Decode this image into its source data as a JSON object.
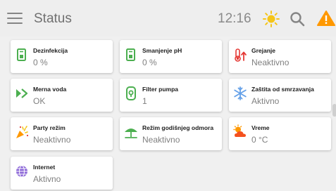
{
  "header": {
    "title": "Status",
    "time": "12:16",
    "menu_icon": "hamburger-menu-icon",
    "weather_icon": "sun-icon",
    "search_icon": "search-icon",
    "alert_icon": "warning-icon"
  },
  "colors": {
    "green": "#4caf50",
    "red": "#e53935",
    "orange": "#ff9800",
    "blue": "#64a0e8",
    "purple": "#8e6ad8",
    "yellow": "#f5c518"
  },
  "tiles": [
    {
      "label": "Dezinfekcija",
      "value": "0 %",
      "icon": "dosing-pump-icon"
    },
    {
      "label": "Smanjenje pH",
      "value": "0 %",
      "icon": "dosing-pump-icon"
    },
    {
      "label": "Grejanje",
      "value": "Neaktivno",
      "icon": "heating-thermometer-icon"
    },
    {
      "label": "Merna voda",
      "value": "OK",
      "icon": "flow-arrows-icon"
    },
    {
      "label": "Filter pumpa",
      "value": "1",
      "icon": "filter-pump-icon"
    },
    {
      "label": "Zaštita od smrzavanja",
      "value": "Aktivno",
      "icon": "snowflake-icon"
    },
    {
      "label": "Party režim",
      "value": "Neaktivno",
      "icon": "party-icon"
    },
    {
      "label": "Režim godišnjeg odmora",
      "value": "Neaktivno",
      "icon": "beach-umbrella-icon"
    },
    {
      "label": "Vreme",
      "value": "0 °C",
      "icon": "weather-sun-cloud-icon"
    },
    {
      "label": "Internet",
      "value": "Aktivno",
      "icon": "globe-icon"
    }
  ]
}
